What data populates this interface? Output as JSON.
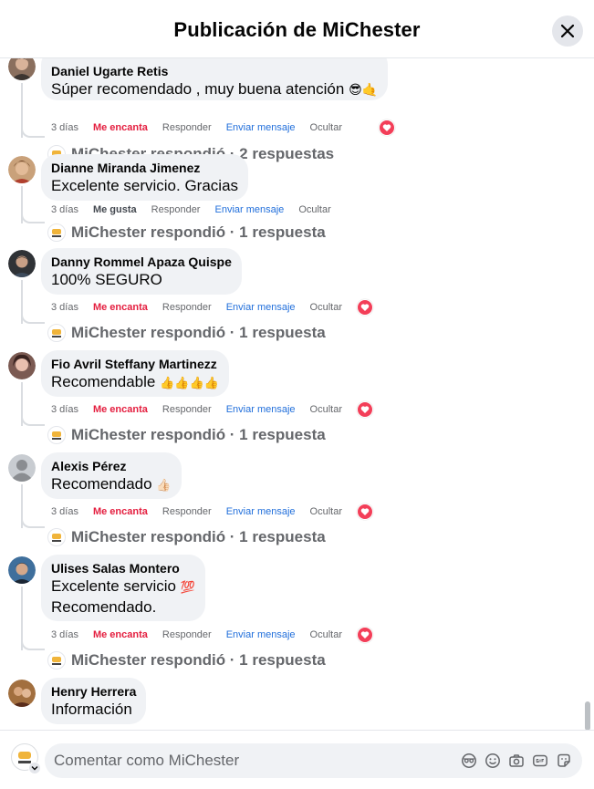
{
  "header": {
    "title": "Publicación de MiChester"
  },
  "actions_labels": {
    "love": "Me encanta",
    "like": "Me gusta",
    "reply": "Responder",
    "message": "Enviar mensaje",
    "hide": "Ocultar"
  },
  "comments": [
    {
      "author": "Daniel Ugarte Retis",
      "text": "Súper recomendado , muy buena atención",
      "emoji": "😎🤙",
      "time": "3 días",
      "reaction": "Me encanta",
      "reply_summary": "MiChester respondió · 2 respuestas"
    },
    {
      "author": "Dianne Miranda Jimenez",
      "text": "Excelente servicio. Gracias",
      "emoji": "",
      "time": "3 días",
      "reaction": "Me gusta",
      "reply_summary": "MiChester respondió · 1 respuesta"
    },
    {
      "author": "Danny Rommel Apaza Quispe",
      "text": "100% SEGURO",
      "emoji": "",
      "time": "3 días",
      "reaction": "Me encanta",
      "reply_summary": "MiChester respondió · 1 respuesta"
    },
    {
      "author": "Fio Avril Steffany Martinezz",
      "text": "Recomendable",
      "emoji": "👍👍👍👍",
      "time": "3 días",
      "reaction": "Me encanta",
      "reply_summary": "MiChester respondió · 1 respuesta"
    },
    {
      "author": "Alexis Pérez",
      "text": "Recomendado",
      "emoji": "👍🏻",
      "time": "3 días",
      "reaction": "Me encanta",
      "reply_summary": "MiChester respondió · 1 respuesta"
    },
    {
      "author": "Ulises Salas Montero",
      "text": "Excelente servicio",
      "emoji": "💯",
      "text2": "Recomendado.",
      "time": "3 días",
      "reaction": "Me encanta",
      "reply_summary": "MiChester respondió · 1 respuesta"
    },
    {
      "author": "Henry Herrera",
      "text": "Información",
      "emoji": ""
    }
  ],
  "composer": {
    "placeholder": "Comentar como MiChester"
  },
  "colors": {
    "love": "#e41e3f",
    "message_link": "#216fdb",
    "bubble": "#f0f2f5",
    "heart_badge": "#f33e58"
  },
  "icons": {
    "close": "close-icon",
    "heart": "heart-icon",
    "tools": [
      "avatar-sticker-icon",
      "emoji-icon",
      "camera-icon",
      "gif-icon",
      "sticker-icon"
    ]
  }
}
